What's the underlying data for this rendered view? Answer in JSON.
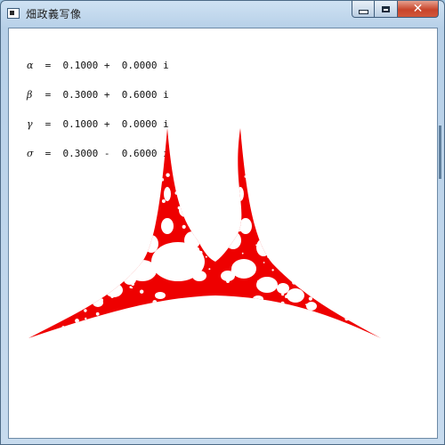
{
  "window": {
    "title": "畑政義写像",
    "icon": "app-window-icon",
    "buttons": {
      "minimize": "minimize-icon",
      "maximize": "maximize-icon",
      "close": "close-icon"
    }
  },
  "params": [
    {
      "symbol": "α",
      "text": " =  0.1000 +  0.0000 i"
    },
    {
      "symbol": "β",
      "text": " =  0.3000 +  0.6000 i"
    },
    {
      "symbol": "γ",
      "text": " =  0.1000 +  0.0000 i"
    },
    {
      "symbol": "σ",
      "text": " =  0.3000 -  0.6000 i"
    }
  ],
  "colors": {
    "fractal": "#ee0000",
    "background": "#ffffff"
  }
}
